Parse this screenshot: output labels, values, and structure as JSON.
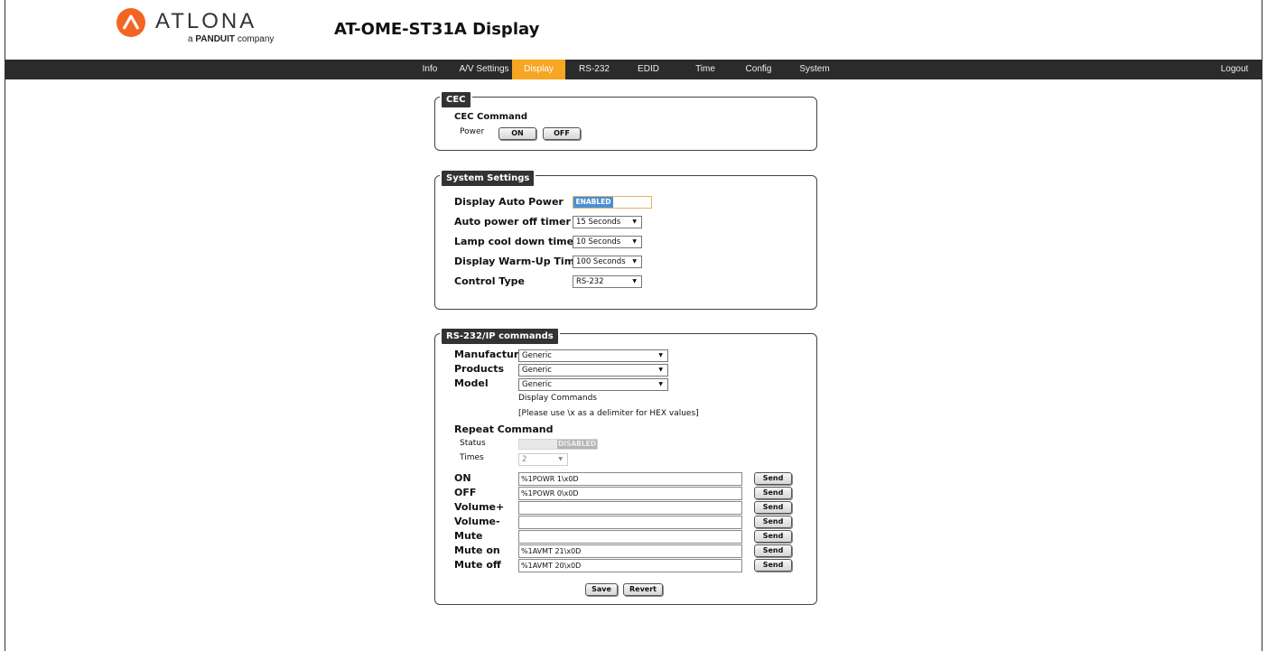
{
  "brand": {
    "name": "ATLONA",
    "sub_prefix": "a",
    "sub_brand": "PANDUIT",
    "sub_suffix": "company",
    "color": "#f26522"
  },
  "page_title": "AT-OME-ST31A  Display",
  "nav": {
    "items": [
      "Info",
      "A/V Settings",
      "Display",
      "RS-232",
      "EDID",
      "Time",
      "Config",
      "System"
    ],
    "active": "Display",
    "logout": "Logout",
    "active_color": "#f5a623"
  },
  "cec": {
    "legend": "CEC",
    "command_label": "CEC Command",
    "power_label": "Power",
    "on_label": "ON",
    "off_label": "OFF"
  },
  "system_settings": {
    "legend": "System Settings",
    "auto_power_label": "Display Auto Power",
    "auto_power_state": "ENABLED",
    "auto_off_label": "Auto power off timer",
    "auto_off_value": "15 Seconds",
    "lamp_label": "Lamp cool down timer",
    "lamp_value": "10 Seconds",
    "warmup_label": "Display Warm-Up Timer",
    "warmup_value": "100 Seconds",
    "control_label": "Control Type",
    "control_value": "RS-232"
  },
  "rs232": {
    "legend": "RS-232/IP commands",
    "manufacturer_label": "Manufacturer",
    "manufacturer_value": "Generic",
    "products_label": "Products",
    "products_value": "Generic",
    "model_label": "Model",
    "model_value": "Generic",
    "display_commands": "Display Commands",
    "hex_note": "[Please use \\x as a delimiter for HEX values]",
    "repeat_label": "Repeat Command",
    "status_label": "Status",
    "status_value": "DISABLED",
    "times_label": "Times",
    "times_value": "2",
    "send_label": "Send",
    "commands": [
      {
        "label": "ON",
        "value": "%1POWR 1\\x0D"
      },
      {
        "label": "OFF",
        "value": "%1POWR 0\\x0D"
      },
      {
        "label": "Volume+",
        "value": ""
      },
      {
        "label": "Volume-",
        "value": ""
      },
      {
        "label": "Mute",
        "value": ""
      },
      {
        "label": "Mute on",
        "value": "%1AVMT 21\\x0D"
      },
      {
        "label": "Mute off",
        "value": "%1AVMT 20\\x0D"
      }
    ],
    "save_label": "Save",
    "revert_label": "Revert"
  }
}
